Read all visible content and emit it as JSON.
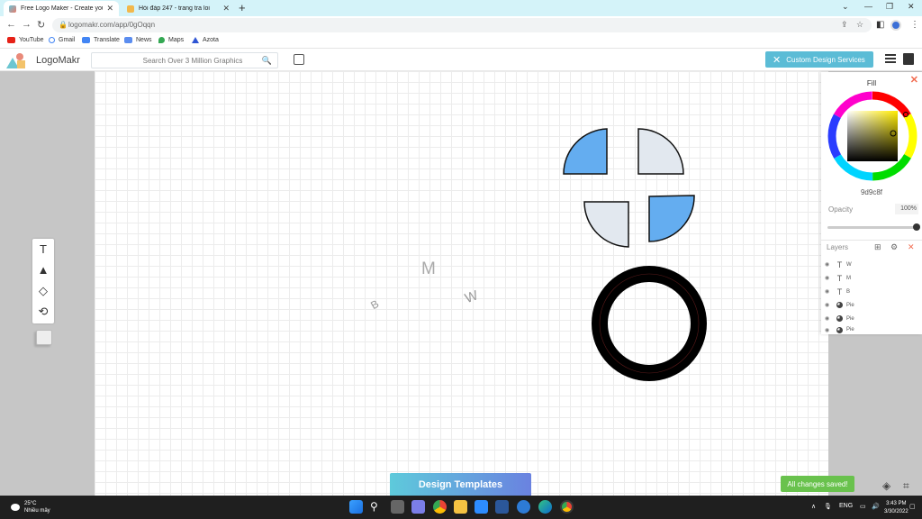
{
  "browser": {
    "tabs": [
      {
        "title": "Free Logo Maker - Create your c",
        "active": true
      },
      {
        "title": "Hỏi đáp 247 - trang tra loi",
        "active": false
      }
    ],
    "url": "logomakr.com/app/0gOqqn",
    "bookmarks": [
      "YouTube",
      "Gmail",
      "Translate",
      "News",
      "Maps",
      "Azota"
    ]
  },
  "app": {
    "logo": "LogoMakr",
    "search_placeholder": "Search Over 3 Million Graphics",
    "custom_design": "Custom Design Services",
    "design_templates": "Design Templates",
    "saved_status": "All changes saved!",
    "canvas_letters": {
      "m": "M",
      "b": "B",
      "w": "W"
    }
  },
  "fill_panel": {
    "title": "Fill",
    "hex": "9d9c8f",
    "opacity_label": "Opacity",
    "opacity_value": "100%",
    "opacity_fraction": 1.0,
    "layers_label": "Layers",
    "layers": [
      {
        "type": "text",
        "name": "W"
      },
      {
        "type": "text",
        "name": "M"
      },
      {
        "type": "text",
        "name": "B"
      },
      {
        "type": "pie",
        "name": "Pie"
      },
      {
        "type": "pie",
        "name": "Pie"
      },
      {
        "type": "pie",
        "name": "Pie"
      }
    ]
  },
  "colors": {
    "quarter_blue": "#64adf0",
    "quarter_light": "#e2e8ef",
    "accent": "#5bbcd6",
    "saved_green": "#69c24d"
  },
  "taskbar": {
    "temperature": "25°C",
    "weather_desc": "Nhiều mây",
    "language": "ENG",
    "time": "3:43 PM",
    "date": "3/30/2022"
  }
}
